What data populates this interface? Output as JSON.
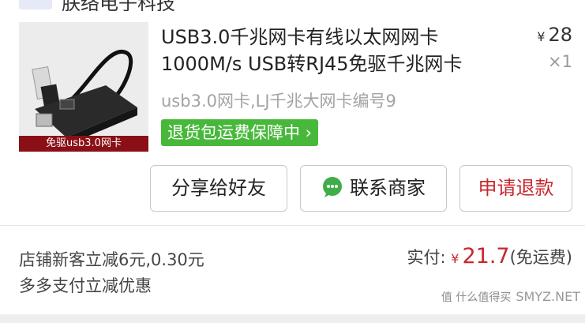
{
  "shop": {
    "name": "朕络电子科技"
  },
  "product": {
    "title": "USB3.0千兆网卡有线以太网网卡 1000M/s USB转RJ45免驱千兆网卡",
    "price_symbol": "¥",
    "price": "28",
    "quantity": "×1",
    "sku": "usb3.0网卡,LJ千兆大网卡编号9",
    "badge": "退货包运费保障中",
    "image_caption": "免驱usb3.0网卡"
  },
  "actions": {
    "share": "分享给好友",
    "contact": "联系商家",
    "refund": "申请退款"
  },
  "promo": {
    "line1": "店铺新客立减6元,0.30元",
    "line2": "多多支付立减优惠"
  },
  "payment": {
    "label": "实付:",
    "symbol": "¥",
    "amount": "21.7",
    "note": "(免运费)"
  },
  "watermark": {
    "cn": "值 什么值得买",
    "en": "SMYZ.NET"
  }
}
